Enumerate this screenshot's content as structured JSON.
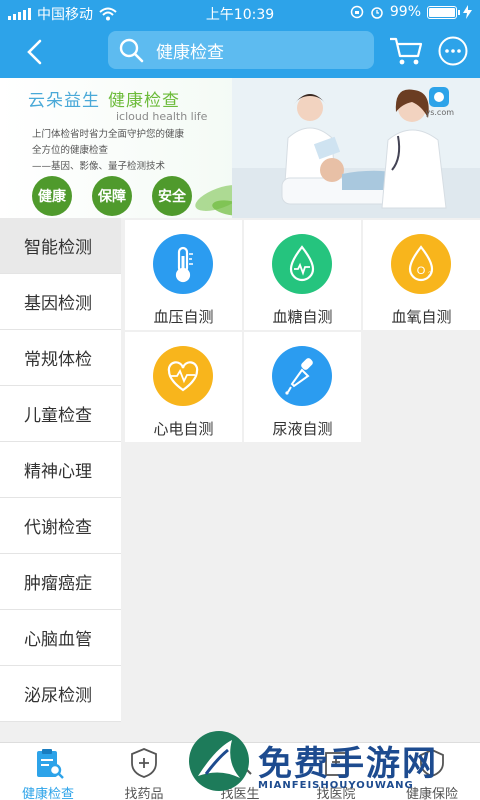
{
  "status_bar": {
    "carrier": "中国移动",
    "time": "上午10:39",
    "battery_percent": "99%",
    "battery_level": 0.99
  },
  "nav": {
    "search_text": "健康检查"
  },
  "banner": {
    "brand_cn": "云朵益生",
    "brand_sub_cn": "健康检查",
    "brand_en": "icloud health life",
    "lines": [
      "上门体检省时省力全面守护您的健康",
      "全方位的健康检查",
      "——基因、影像、量子检测技术"
    ],
    "badges": [
      "健康",
      "保障",
      "安全"
    ],
    "logo_text": "ys.com"
  },
  "sidebar": {
    "items": [
      "智能检测",
      "基因检测",
      "常规体检",
      "儿童检查",
      "精神心理",
      "代谢检查",
      "肿瘤癌症",
      "心脑血管",
      "泌尿检测"
    ],
    "active_index": 0
  },
  "content": {
    "cards": [
      {
        "label": "血压自测",
        "icon": "thermometer-icon",
        "color": "#2b9cf0"
      },
      {
        "label": "血糖自测",
        "icon": "blood-drop-icon",
        "color": "#25c47e"
      },
      {
        "label": "血氧自测",
        "icon": "oxygen-drop-icon",
        "color": "#f8b51c"
      },
      {
        "label": "心电自测",
        "icon": "heartbeat-icon",
        "color": "#f8b51c"
      },
      {
        "label": "尿液自测",
        "icon": "dropper-icon",
        "color": "#2b9cf0"
      }
    ]
  },
  "tabbar": {
    "tabs": [
      {
        "label": "健康检查",
        "icon": "clipboard-search-icon"
      },
      {
        "label": "找药品",
        "icon": "medicine-shield-icon"
      },
      {
        "label": "找医生",
        "icon": "doctor-search-icon"
      },
      {
        "label": "找医院",
        "icon": "hospital-icon"
      },
      {
        "label": "健康保险",
        "icon": "insurance-icon"
      }
    ],
    "active_index": 0
  },
  "watermark": {
    "text": "免费手游网",
    "sub": "MIANFEISHOUYOUWANG"
  },
  "colors": {
    "primary": "#2da3e9",
    "green": "#4f9a2c"
  }
}
